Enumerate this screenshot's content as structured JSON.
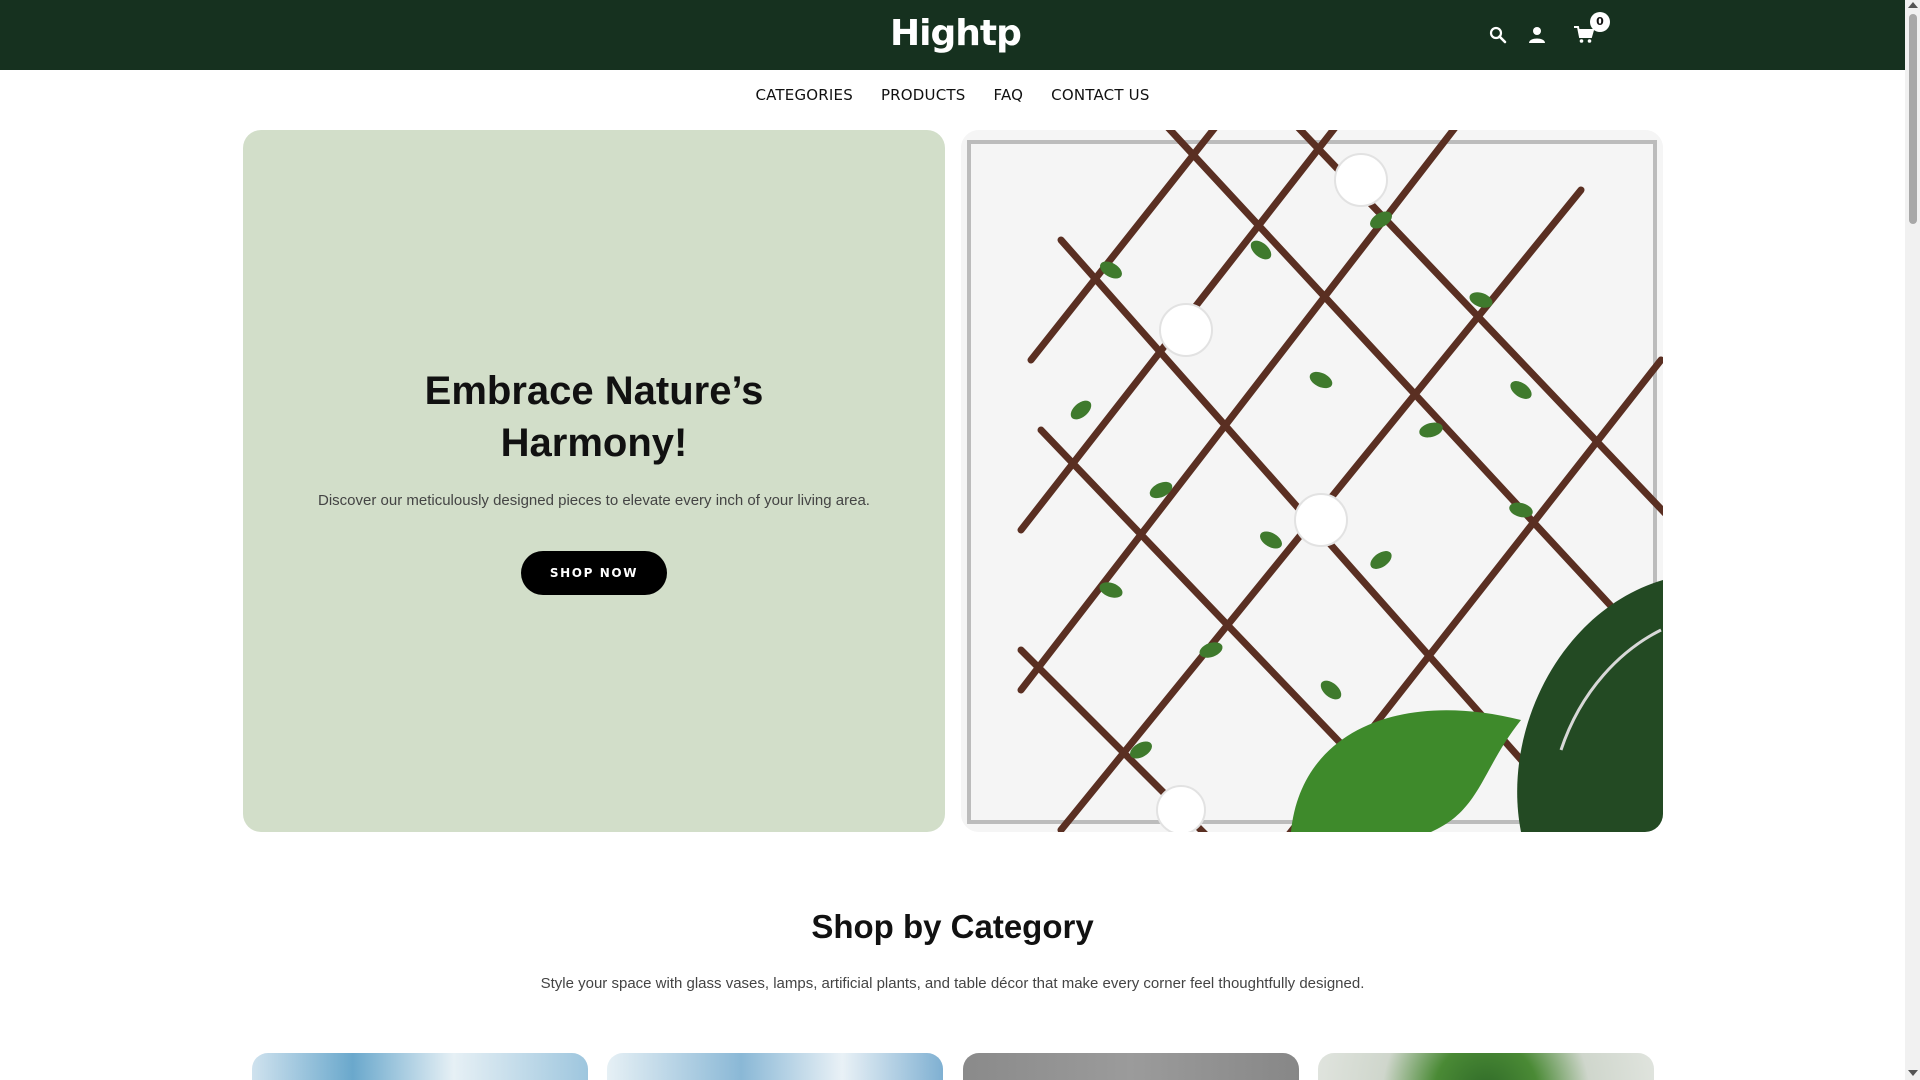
{
  "brand": {
    "logo_text": "Hightp"
  },
  "header": {
    "cart_count": "0"
  },
  "nav": {
    "items": [
      "CATEGORIES",
      "PRODUCTS",
      "FAQ",
      "CONTACT US"
    ]
  },
  "hero": {
    "title_line1": "Embrace Nature’s",
    "title_line2": "Harmony!",
    "subtitle": "Discover our meticulously designed pieces to elevate every inch of your living area.",
    "button_label": "SHOP NOW"
  },
  "category": {
    "title": "Shop by Category",
    "subtitle": "Style your space with glass vases, lamps, artificial plants, and table décor that make every corner feel thoughtfully designed."
  },
  "colors": {
    "header_bg": "#16311f",
    "hero_panel": "#d2dec9",
    "button": "#000000"
  },
  "icons": [
    "search-icon",
    "user-icon",
    "cart-icon"
  ]
}
